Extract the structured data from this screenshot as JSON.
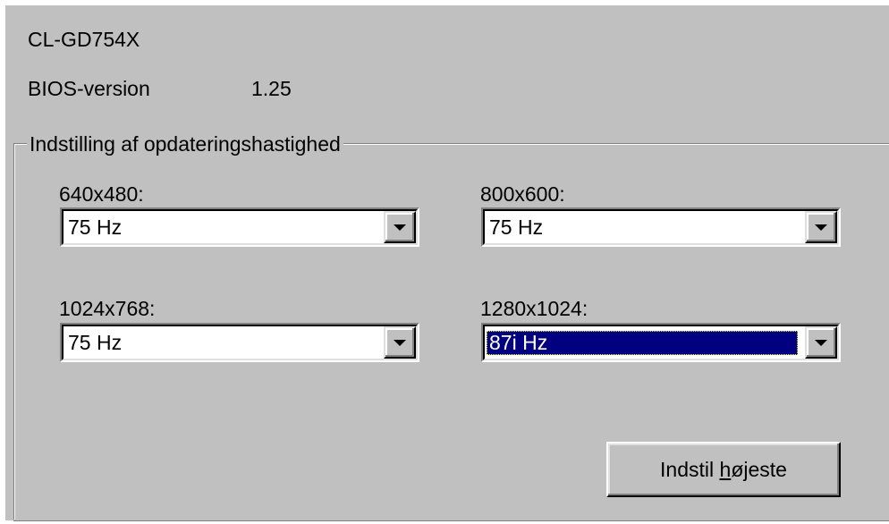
{
  "info": {
    "chip": "CL-GD754X",
    "bios_label": "BIOS-version",
    "bios_value": "1.25"
  },
  "refresh_group": {
    "title": "Indstilling af opdateringshastighed",
    "res_640": {
      "label": "640x480:",
      "value": "75 Hz"
    },
    "res_800": {
      "label": "800x600:",
      "value": "75 Hz"
    },
    "res_1024": {
      "label": "1024x768:",
      "value": "75 Hz"
    },
    "res_1280": {
      "label": "1280x1024:",
      "value": "87i Hz"
    }
  },
  "buttons": {
    "set_highest_prefix": "Indstil ",
    "set_highest_mnemonic": "h",
    "set_highest_suffix": "øjeste"
  },
  "icons": {
    "dropdown": "chevron-down-icon"
  },
  "colors": {
    "panel": "#c0c0c0",
    "selection": "#000080",
    "field": "#ffffff"
  }
}
